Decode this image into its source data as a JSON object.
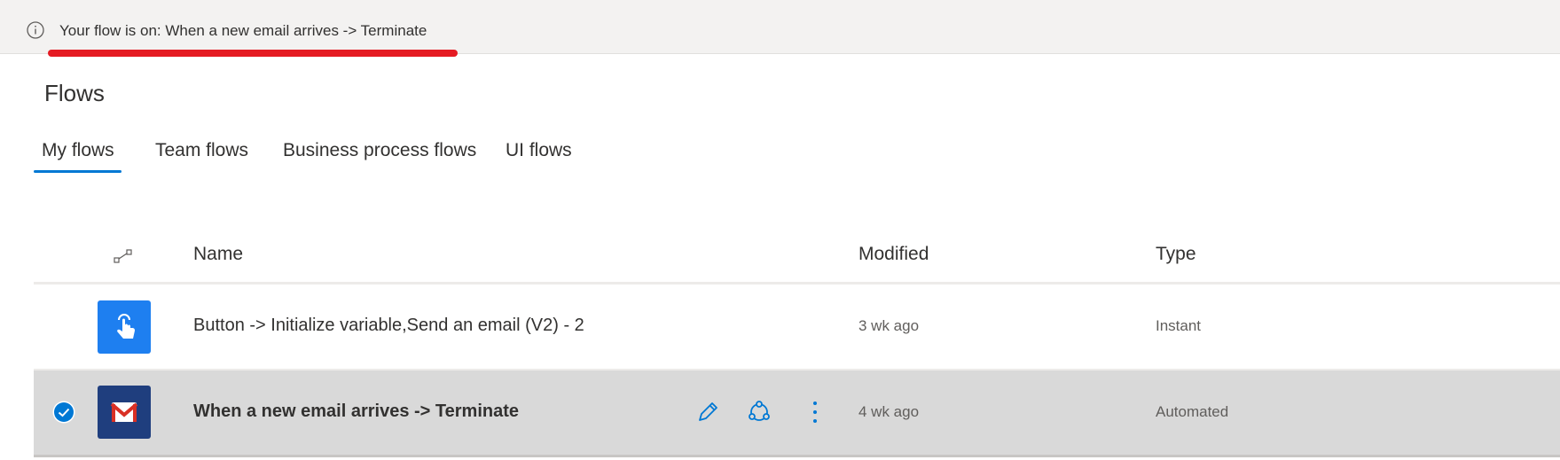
{
  "banner": {
    "message": "Your flow is on: When a new email arrives -> Terminate",
    "icon": "info-icon",
    "underline_color": "#e51b23"
  },
  "page": {
    "title": "Flows"
  },
  "tabs": [
    {
      "label": "My flows",
      "active": true
    },
    {
      "label": "Team flows",
      "active": false
    },
    {
      "label": "Business process flows",
      "active": false
    },
    {
      "label": "UI flows",
      "active": false
    }
  ],
  "table": {
    "headers": {
      "icon": "flow-connector-icon",
      "name": "Name",
      "modified": "Modified",
      "type": "Type"
    },
    "rows": [
      {
        "icon": "touch-button-icon",
        "icon_color": "#1e7ff0",
        "name": "Button -> Initialize variable,Send an email (V2) - 2",
        "modified": "3 wk ago",
        "type": "Instant",
        "selected": false
      },
      {
        "icon": "gmail-icon",
        "icon_color": "#1f3e7e",
        "name": "When a new email arrives -> Terminate",
        "modified": "4 wk ago",
        "type": "Automated",
        "selected": true,
        "actions": [
          "edit-icon",
          "share-icon",
          "more-options-icon"
        ]
      }
    ]
  },
  "colors": {
    "accent": "#0078d4",
    "selected_row": "#d9d9d9"
  }
}
